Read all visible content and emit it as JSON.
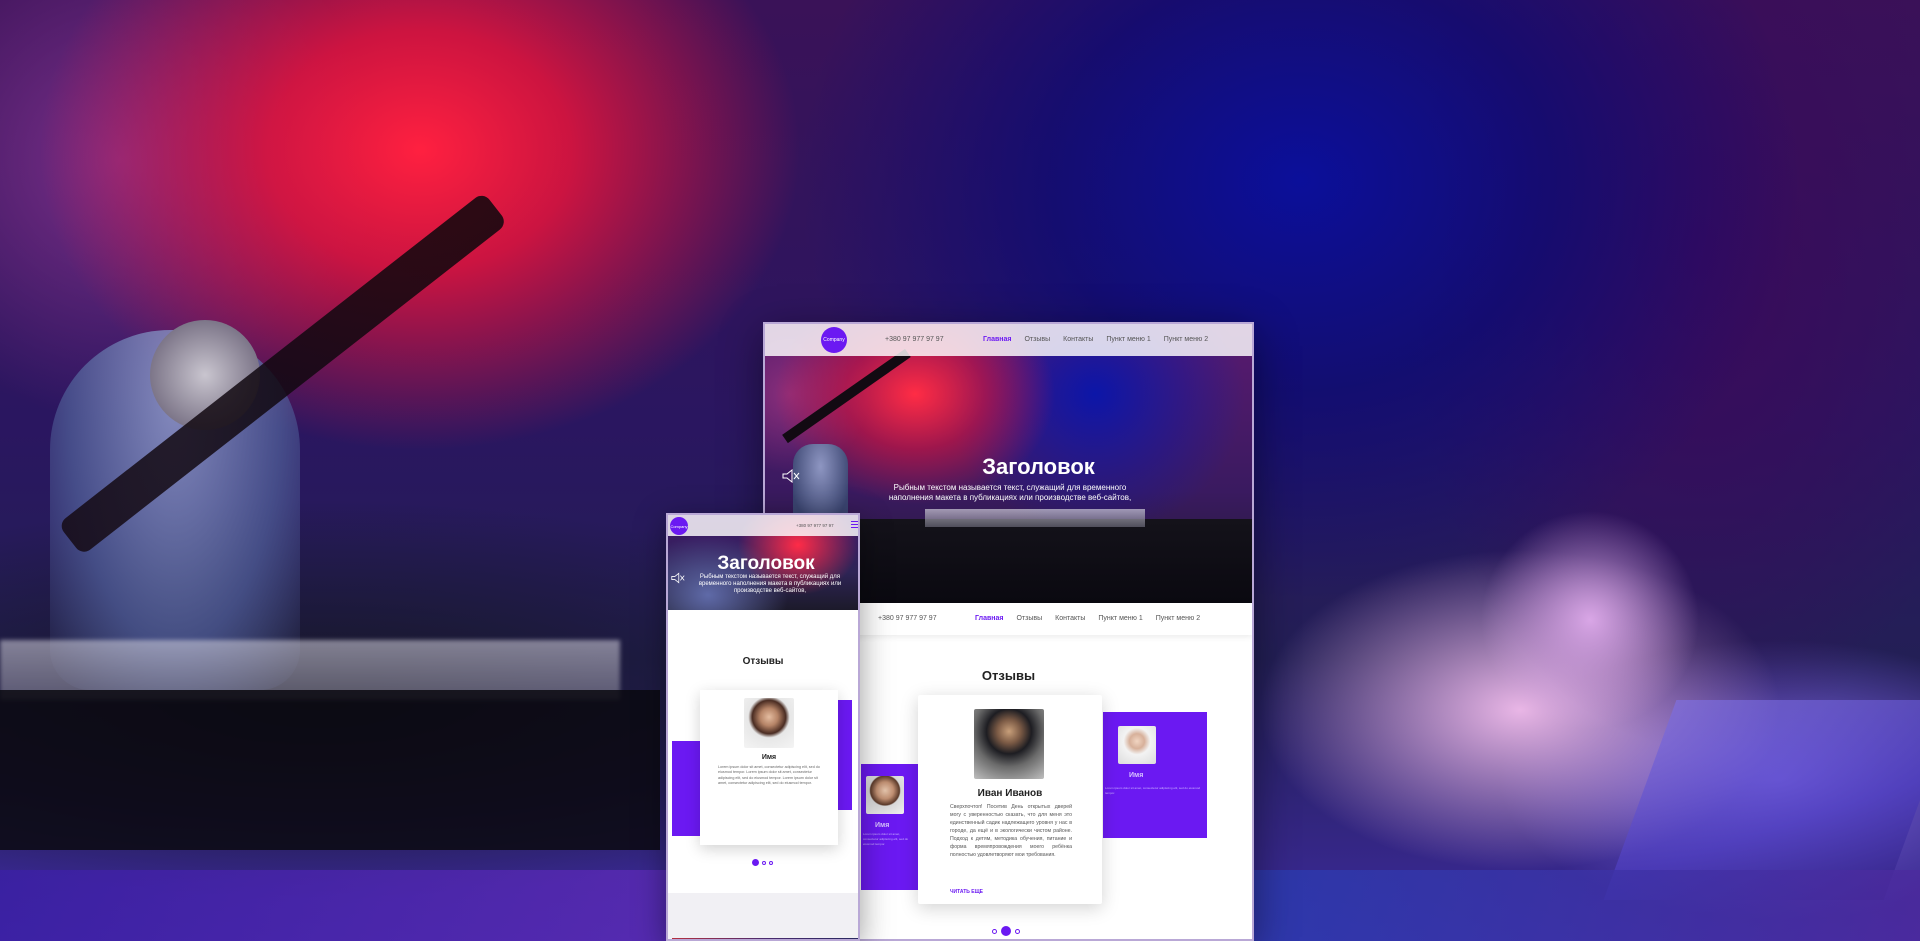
{
  "colors": {
    "accent": "#6b19f2",
    "text_dark": "#222222",
    "text_muted": "#555555"
  },
  "desktop": {
    "nav": {
      "logo_text": "Company",
      "phone": "+380 97 977 97 97",
      "menu": [
        "Главная",
        "Отзывы",
        "Контакты",
        "Пункт меню 1",
        "Пункт меню 2"
      ],
      "active_item": "Главная"
    },
    "hero": {
      "title": "Заголовок",
      "subtitle": "Рыбным текстом называется текст, служащий для временного наполнения макета в публикациях или производстве веб-сайтов,",
      "mute_icon": "speaker-mute-icon"
    },
    "sticky_nav": {
      "phone": "+380 97 977 97 97",
      "menu": [
        "Главная",
        "Отзывы",
        "Контакты",
        "Пункт меню 1",
        "Пункт меню 2"
      ]
    },
    "reviews": {
      "title": "Отзывы",
      "main_card": {
        "name": "Иван Иванов",
        "text": "Сверхпочтоп! Посетив День открытых дверей могу с уверенностью сказать, что для меня это единственный садик надлежащего уровня у нас в городе, да ещё и в экологически чистом районе. Подход к детям, методика обучения, питание и форма времяпровождения моего ребёнка полностью удовлетворяют мои требования.",
        "read_more": "ЧИТАТЬ ЕЩЕ"
      },
      "side_cards": [
        {
          "name": "Имя",
          "text": "Lorem ipsum dolor sit amet, consectetur adipiscing elit, sed do eiusmod tempor."
        },
        {
          "name": "Имя",
          "text": "Lorem ipsum dolor sit amet, consectetur adipiscing elit, sed do eiusmod tempor."
        }
      ],
      "pagination": {
        "total": 3,
        "active": 2
      }
    }
  },
  "mobile": {
    "nav": {
      "logo_text": "Company",
      "phone": "+380 97 977 97 97"
    },
    "hero": {
      "title": "Заголовок",
      "subtitle": "Рыбным текстом называется текст, служащий для временного наполнения макета в публикациях или производстве веб-сайтов,"
    },
    "reviews": {
      "title": "Отзывы",
      "main_card": {
        "name": "Имя",
        "text": "Lorem ipsum dolor sit amet, consectetur adipiscing elit, sed do eiusmod tempor. Lorem ipsum dolor sit amet, consectetur adipiscing elit, sed do eiusmod tempor. Lorem ipsum dolor sit amet, consectetur adipiscing elit, sed do eiusmod tempor."
      },
      "pagination": {
        "total": 3,
        "active": 1
      }
    }
  }
}
